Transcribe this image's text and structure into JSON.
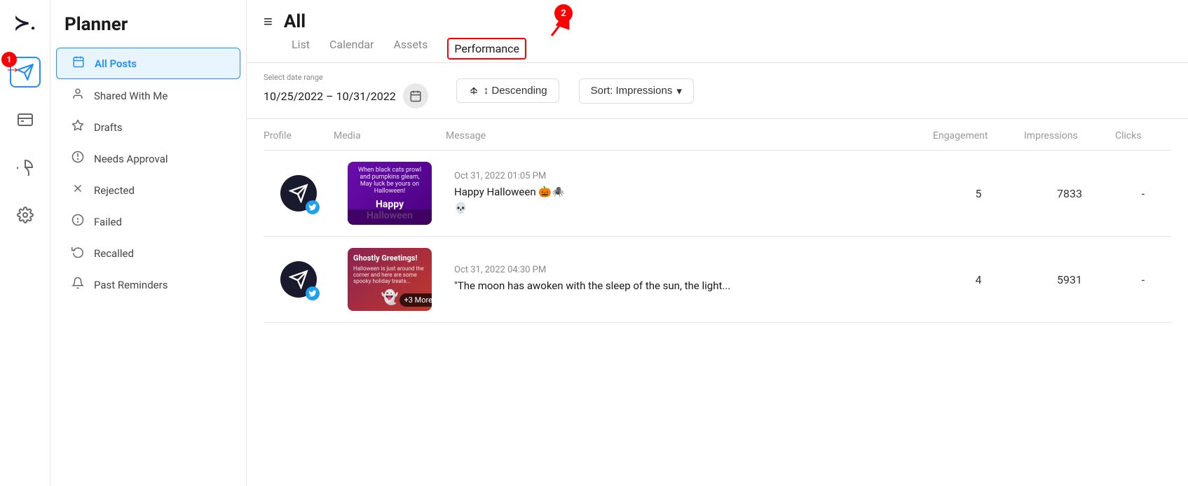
{
  "app": {
    "logo": "≻.",
    "icons": [
      {
        "name": "planner-icon",
        "symbol": "✈",
        "active": true
      },
      {
        "name": "inbox-icon",
        "symbol": "⬛"
      },
      {
        "name": "analytics-icon",
        "symbol": "◑"
      },
      {
        "name": "settings-icon",
        "symbol": "⚙"
      }
    ]
  },
  "sidebar": {
    "title": "Planner",
    "items": [
      {
        "id": "all-posts",
        "label": "All Posts",
        "icon": "📅",
        "active": true
      },
      {
        "id": "shared-with-me",
        "label": "Shared With Me",
        "icon": "👤"
      },
      {
        "id": "drafts",
        "label": "Drafts",
        "icon": "◇"
      },
      {
        "id": "needs-approval",
        "label": "Needs Approval",
        "icon": "⚖"
      },
      {
        "id": "rejected",
        "label": "Rejected",
        "icon": "✕"
      },
      {
        "id": "failed",
        "label": "Failed",
        "icon": "⊙"
      },
      {
        "id": "recalled",
        "label": "Recalled",
        "icon": "↺"
      },
      {
        "id": "past-reminders",
        "label": "Past Reminders",
        "icon": "🔔"
      }
    ]
  },
  "header": {
    "title": "All",
    "hamburger": "≡",
    "tabs": [
      {
        "id": "list",
        "label": "List"
      },
      {
        "id": "calendar",
        "label": "Calendar"
      },
      {
        "id": "assets",
        "label": "Assets"
      },
      {
        "id": "performance",
        "label": "Performance",
        "active": true
      }
    ]
  },
  "filters": {
    "date_label": "Select date range",
    "date_range": "10/25/2022 – 10/31/2022",
    "calendar_icon": "📅",
    "sort_label": "↕ Descending",
    "sort_select_label": "Sort: Impressions",
    "chevron": "▾"
  },
  "table": {
    "columns": [
      "Profile",
      "Media",
      "Message",
      "Engagement",
      "Impressions",
      "Clicks"
    ],
    "rows": [
      {
        "profile_icon": "≻",
        "network": "twitter",
        "media_type": "halloween",
        "media_title": "Happy Halloween",
        "media_subtitle": "When black cats prowl and pumpkins gleam, May luck be yours on Halloween!",
        "timestamp": "Oct 31, 2022 01:05 PM",
        "message": "Happy Halloween 🎃🕷️\n💀",
        "engagement": "5",
        "impressions": "7833",
        "clicks": "-"
      },
      {
        "profile_icon": "≻",
        "network": "twitter",
        "media_type": "ghostly",
        "media_title": "Ghostly Greetings!",
        "media_subtitle": "Halloween is just around the corner and here are some spooky treats...",
        "more": "+3 More",
        "timestamp": "Oct 31, 2022 04:30 PM",
        "message": "\"The moon has awoken with the sleep of the sun, the light...",
        "engagement": "4",
        "impressions": "5931",
        "clicks": "-"
      }
    ]
  },
  "annotations": {
    "badge1": "1",
    "badge2": "2"
  }
}
